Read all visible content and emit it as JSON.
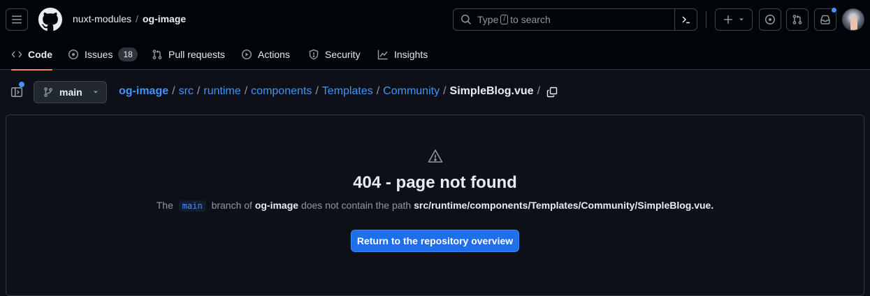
{
  "header": {
    "owner": "nuxt-modules",
    "separator": "/",
    "repo": "og-image",
    "search_placeholder_before": "Type",
    "search_slash": "/",
    "search_placeholder_after": "to search"
  },
  "tabs": [
    {
      "label": "Code",
      "icon": "code-icon",
      "active": true
    },
    {
      "label": "Issues",
      "icon": "issue-icon",
      "count": "18"
    },
    {
      "label": "Pull requests",
      "icon": "pull-request-icon"
    },
    {
      "label": "Actions",
      "icon": "play-icon"
    },
    {
      "label": "Security",
      "icon": "shield-icon"
    },
    {
      "label": "Insights",
      "icon": "graph-icon"
    }
  ],
  "branch": {
    "name": "main"
  },
  "breadcrumb": {
    "items": [
      "og-image",
      "src",
      "runtime",
      "components",
      "Templates",
      "Community"
    ],
    "separator": "/",
    "file": "SimpleBlog.vue",
    "trailing": "/"
  },
  "error": {
    "title": "404 - page not found",
    "desc_prefix": "The",
    "branch_code": "main",
    "desc_mid": "branch of",
    "repo": "og-image",
    "desc_mid2": "does not contain the path",
    "path": "src/runtime/components/Templates/Community/SimpleBlog.vue.",
    "button_label": "Return to the repository overview"
  },
  "colors": {
    "accent": "#4493f8",
    "active_tab_underline": "#f78166",
    "primary_button": "#1f6feb",
    "notification_dot": "#4493f8"
  }
}
